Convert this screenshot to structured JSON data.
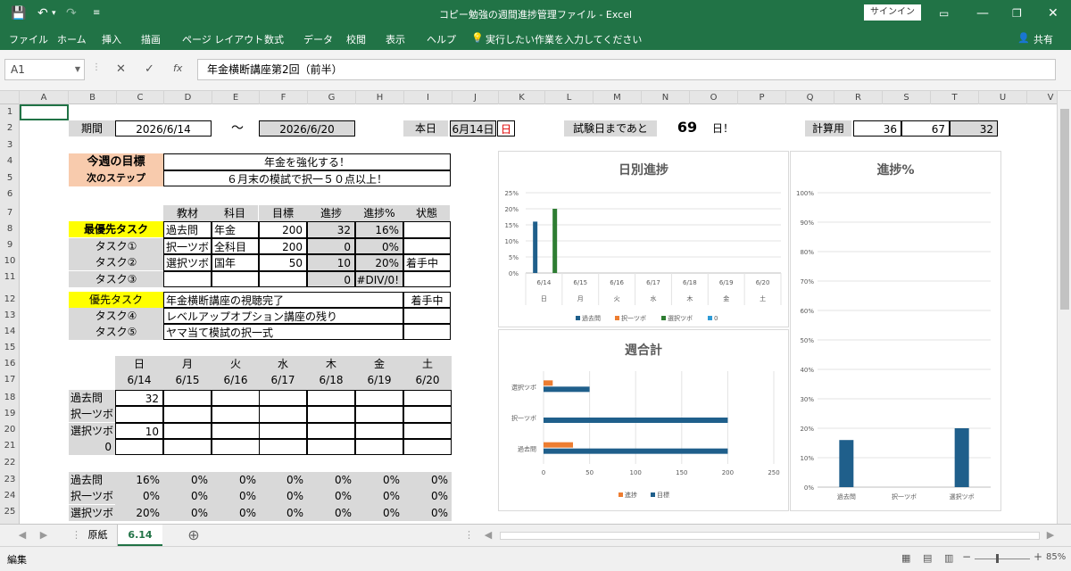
{
  "window": {
    "title": "コピー勉強の週間進捗管理ファイル  -  Excel",
    "signin": "サインイン",
    "share": "共有"
  },
  "menu": [
    "ファイル",
    "ホーム",
    "挿入",
    "描画",
    "ページ レイアウト",
    "数式",
    "データ",
    "校閲",
    "表示",
    "ヘルプ"
  ],
  "tellme": "実行したい作業を入力してください",
  "formula": {
    "namebox": "A1",
    "fx": "fx",
    "content": "年金横断講座第2回（前半）"
  },
  "columns": [
    "A",
    "B",
    "C",
    "D",
    "E",
    "F",
    "G",
    "H",
    "I",
    "J",
    "K",
    "L",
    "M",
    "N",
    "O",
    "P",
    "Q",
    "R",
    "S",
    "T",
    "U",
    "V"
  ],
  "rows": [
    "1",
    "2",
    "3",
    "4",
    "5",
    "6",
    "7",
    "8",
    "9",
    "10",
    "11",
    "12",
    "13",
    "14",
    "15",
    "16",
    "17",
    "18",
    "19",
    "20",
    "21",
    "22",
    "23",
    "24",
    "25"
  ],
  "sheet": {
    "period_label": "期間",
    "start": "2026/6/14",
    "tilde": "～",
    "end": "2026/6/20",
    "today_label": "本日",
    "today": "6月14日",
    "today_dow": "日",
    "exam_label": "試験日まであと",
    "exam_days": "69",
    "exam_suffix": "日！",
    "calc_label": "計算用",
    "calc": [
      "36",
      "67",
      "32"
    ],
    "goal_label": "今週の目標",
    "goal": "年金を強化する！",
    "next_label": "次のステップ",
    "next": "６月末の模試で択一５０点以上！",
    "headers": [
      "教材",
      "科目",
      "目標",
      "進捗",
      "進捗%",
      "状態"
    ],
    "tasks": [
      {
        "label": "最優先タスク",
        "material": "過去問",
        "subject": "年金",
        "target": "200",
        "progress": "32",
        "pct": "16%",
        "status": ""
      },
      {
        "label": "タスク①",
        "material": "択一ツボ",
        "subject": "全科目",
        "target": "200",
        "progress": "0",
        "pct": "0%",
        "status": ""
      },
      {
        "label": "タスク②",
        "material": "選択ツボ",
        "subject": "国年",
        "target": "50",
        "progress": "10",
        "pct": "20%",
        "status": "着手中"
      },
      {
        "label": "タスク③",
        "material": "",
        "subject": "",
        "target": "",
        "progress": "0",
        "pct": "#DIV/0!",
        "status": ""
      }
    ],
    "priority": {
      "label": "優先タスク",
      "text": "年金横断講座の視聴完了",
      "status": "着手中"
    },
    "task4": {
      "label": "タスク④",
      "text": "レベルアップオプション講座の残り"
    },
    "task5": {
      "label": "タスク⑤",
      "text": "ヤマ当て模試の択一式"
    },
    "days": [
      "日",
      "月",
      "火",
      "水",
      "木",
      "金",
      "土"
    ],
    "dates": [
      "6/14",
      "6/15",
      "6/16",
      "6/17",
      "6/18",
      "6/19",
      "6/20"
    ],
    "log_rows": [
      {
        "label": "過去問",
        "values": [
          "32",
          "",
          "",
          "",
          "",
          "",
          ""
        ]
      },
      {
        "label": "択一ツボ",
        "values": [
          "",
          "",
          "",
          "",
          "",
          "",
          ""
        ]
      },
      {
        "label": "選択ツボ",
        "values": [
          "10",
          "",
          "",
          "",
          "",
          "",
          ""
        ]
      },
      {
        "label": "0",
        "values": [
          "",
          "",
          "",
          "",
          "",
          "",
          ""
        ]
      }
    ],
    "pct_rows": [
      {
        "label": "過去問",
        "values": [
          "16%",
          "0%",
          "0%",
          "0%",
          "0%",
          "0%",
          "0%"
        ]
      },
      {
        "label": "択一ツボ",
        "values": [
          "0%",
          "0%",
          "0%",
          "0%",
          "0%",
          "0%",
          "0%"
        ]
      },
      {
        "label": "選択ツボ",
        "values": [
          "20%",
          "0%",
          "0%",
          "0%",
          "0%",
          "0%",
          "0%"
        ]
      }
    ]
  },
  "chart_data": [
    {
      "type": "bar",
      "title": "日別進捗",
      "categories": [
        "6/14\n日",
        "6/15\n月",
        "6/16\n火",
        "6/17\n水",
        "6/18\n木",
        "6/19\n金",
        "6/20\n土"
      ],
      "tick_dates": [
        "6/14",
        "6/15",
        "6/16",
        "6/17",
        "6/18",
        "6/19",
        "6/20"
      ],
      "tick_days": [
        "日",
        "月",
        "火",
        "水",
        "木",
        "金",
        "土"
      ],
      "yticks": [
        "25%",
        "20%",
        "15%",
        "10%",
        "5%",
        "0%"
      ],
      "ylim": [
        0,
        25
      ],
      "series": [
        {
          "name": "過去問",
          "color": "#1f5f8b",
          "values": [
            16,
            0,
            0,
            0,
            0,
            0,
            0
          ]
        },
        {
          "name": "択一ツボ",
          "color": "#ed7d31",
          "values": [
            0,
            0,
            0,
            0,
            0,
            0,
            0
          ]
        },
        {
          "name": "選択ツボ",
          "color": "#2e7d32",
          "values": [
            20,
            0,
            0,
            0,
            0,
            0,
            0
          ]
        },
        {
          "name": "0",
          "color": "#2e9bd6",
          "values": [
            0,
            0,
            0,
            0,
            0,
            0,
            0
          ]
        }
      ],
      "legend": "bottom"
    },
    {
      "type": "bar",
      "orientation": "horizontal",
      "title": "週合計",
      "categories": [
        "選択ツボ",
        "択一ツボ",
        "過去問"
      ],
      "xticks": [
        "0",
        "50",
        "100",
        "150",
        "200",
        "250"
      ],
      "xlim": [
        0,
        250
      ],
      "series": [
        {
          "name": "進捗",
          "color": "#ed7d31",
          "values": [
            10,
            0,
            32
          ]
        },
        {
          "name": "目標",
          "color": "#1f5f8b",
          "values": [
            50,
            200,
            200
          ]
        }
      ],
      "legend": "bottom"
    },
    {
      "type": "bar",
      "title": "進捗%",
      "categories": [
        "過去問",
        "択一ツボ",
        "選択ツボ"
      ],
      "yticks": [
        "100%",
        "90%",
        "80%",
        "70%",
        "60%",
        "50%",
        "40%",
        "30%",
        "20%",
        "10%",
        "0%"
      ],
      "ylim": [
        0,
        100
      ],
      "series": [
        {
          "name": "進捗%",
          "color": "#1f5f8b",
          "values": [
            16,
            0,
            20
          ]
        }
      ]
    }
  ],
  "tabs": {
    "sheet1": "原紙",
    "sheet2": "6.14"
  },
  "status": {
    "mode": "編集",
    "zoom": "85%"
  }
}
